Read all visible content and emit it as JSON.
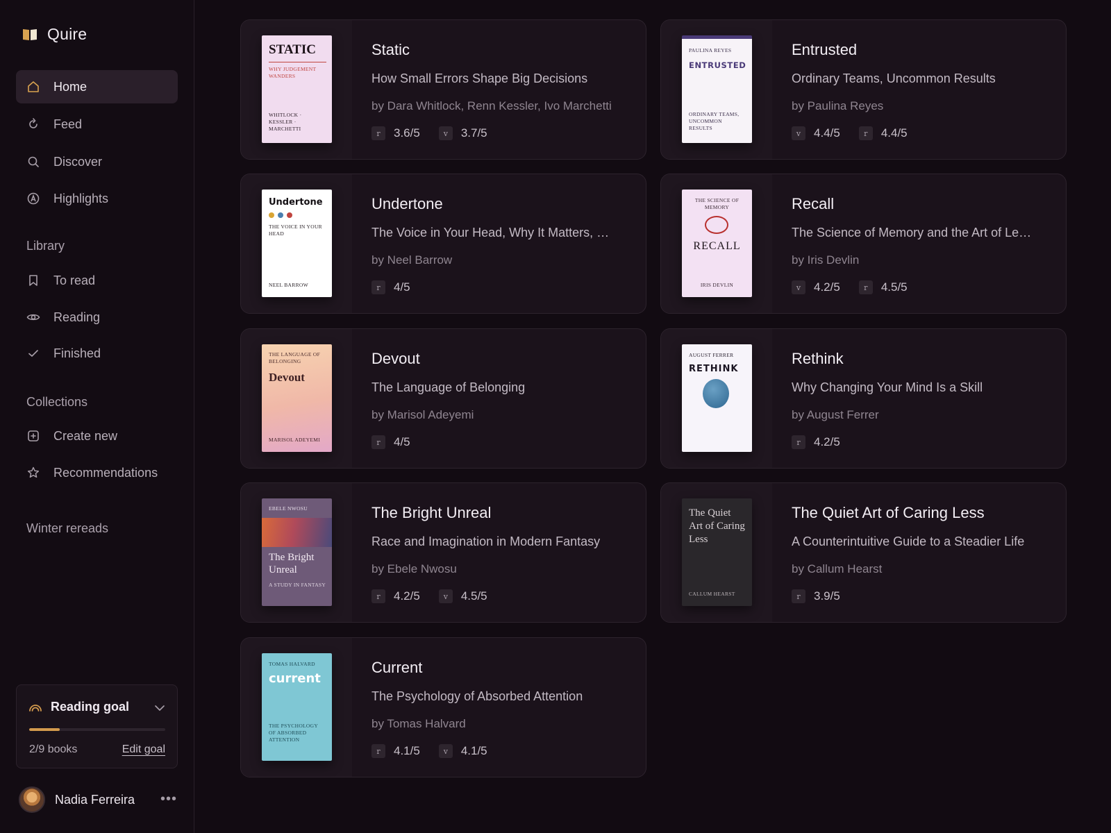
{
  "app": {
    "name": "Quire"
  },
  "nav": [
    {
      "label": "Home",
      "icon": "home-icon",
      "active": true
    },
    {
      "label": "Feed",
      "icon": "refresh-icon"
    },
    {
      "label": "Discover",
      "icon": "search-icon"
    },
    {
      "label": "Highlights",
      "icon": "highlight-icon"
    }
  ],
  "library": {
    "label": "Library",
    "items": [
      {
        "label": "To read",
        "icon": "bookmark-icon"
      },
      {
        "label": "Reading",
        "icon": "eye-icon"
      },
      {
        "label": "Finished",
        "icon": "check-icon"
      }
    ]
  },
  "collections": {
    "label": "Collections",
    "items": [
      {
        "label": "Create new",
        "icon": "plus-square-icon"
      },
      {
        "label": "Recommendations",
        "icon": "star-icon"
      }
    ],
    "custom": "Winter rereads"
  },
  "goal": {
    "title": "Reading goal",
    "count": "2/9 books",
    "edit": "Edit goal",
    "progress": 0.222,
    "color": "#d39a4d"
  },
  "user": {
    "name": "Nadia Ferreira",
    "more": "•••"
  },
  "books": [
    {
      "title": "Static",
      "subtitle": "How Small Errors Shape Big Decisions",
      "author": "by Dara Whitlock, Renn Kessler, Ivo Marchetti",
      "ratings": [
        {
          "icon": "r",
          "value": "3.6/5"
        },
        {
          "icon": "v",
          "value": "3.7/5"
        }
      ],
      "cover": {
        "title": "STATIC",
        "tagline": "WHY JUDGEMENT WANDERS",
        "author": "WHITLOCK · KESSLER · MARCHETTI",
        "bg": "#f1dcef",
        "accent": "#c0453f"
      }
    },
    {
      "title": "Entrusted",
      "subtitle": "Ordinary Teams, Uncommon Results",
      "author": "by Paulina Reyes",
      "ratings": [
        {
          "icon": "v",
          "value": "4.4/5"
        },
        {
          "icon": "r",
          "value": "4.4/5"
        }
      ],
      "cover": {
        "title": "ENTRUSTED",
        "tagline": "ORDINARY TEAMS, UNCOMMON RESULTS",
        "author": "PAULINA REYES",
        "bg": "#f7f3f8",
        "accent": "#4a3a78"
      }
    },
    {
      "title": "Undertone",
      "subtitle": "The Voice in Your Head, Why It Matters, …",
      "author": "by Neel Barrow",
      "ratings": [
        {
          "icon": "r",
          "value": "4/5"
        }
      ],
      "cover": {
        "title": "Undertone",
        "tagline": "THE VOICE IN YOUR HEAD",
        "author": "NEEL BARROW",
        "bg": "#ffffff",
        "accent": "#1a1a1a"
      }
    },
    {
      "title": "Recall",
      "subtitle": "The Science of Memory and the Art of Le…",
      "author": "by Iris Devlin",
      "ratings": [
        {
          "icon": "v",
          "value": "4.2/5"
        },
        {
          "icon": "r",
          "value": "4.5/5"
        }
      ],
      "cover": {
        "title": "RECALL",
        "tagline": "THE SCIENCE OF MEMORY",
        "author": "IRIS DEVLIN",
        "bg": "#f3e1f3",
        "accent": "#b8302e"
      }
    },
    {
      "title": "Devout",
      "subtitle": "The Language of Belonging",
      "author": "by Marisol Adeyemi",
      "ratings": [
        {
          "icon": "r",
          "value": "4/5"
        }
      ],
      "cover": {
        "title": "Devout",
        "tagline": "THE LANGUAGE OF BELONGING",
        "author": "MARISOL ADEYEMI",
        "bg": "#f0c6a8",
        "accent": "#3d1f22"
      }
    },
    {
      "title": "Rethink",
      "subtitle": "Why Changing Your Mind Is a Skill",
      "author": "by August Ferrer",
      "ratings": [
        {
          "icon": "r",
          "value": "4.2/5"
        }
      ],
      "cover": {
        "title": "RETHINK",
        "tagline": "",
        "author": "AUGUST FERRER",
        "bg": "#f7f4fa",
        "accent": "#3f7aa5"
      }
    },
    {
      "title": "The Bright Unreal",
      "subtitle": "Race and Imagination in Modern Fantasy",
      "author": "by Ebele Nwosu",
      "ratings": [
        {
          "icon": "r",
          "value": "4.2/5"
        },
        {
          "icon": "v",
          "value": "4.5/5"
        }
      ],
      "cover": {
        "title": "The Bright Unreal",
        "tagline": "A STUDY IN FANTASY",
        "author": "EBELE NWOSU",
        "bg": "#6e5a78",
        "accent": "#d86a3a"
      }
    },
    {
      "title": "The Quiet Art of Caring Less",
      "subtitle": "A Counterintuitive Guide to a Steadier Life",
      "author": "by Callum Hearst",
      "ratings": [
        {
          "icon": "r",
          "value": "3.9/5"
        }
      ],
      "cover": {
        "title": "The Quiet Art of Caring Less",
        "tagline": "",
        "author": "CALLUM HEARST",
        "bg": "#2a272b",
        "accent": "#cfc8c8"
      }
    },
    {
      "title": "Current",
      "subtitle": "The Psychology of Absorbed Attention",
      "author": "by Tomas Halvard",
      "ratings": [
        {
          "icon": "r",
          "value": "4.1/5"
        },
        {
          "icon": "v",
          "value": "4.1/5"
        }
      ],
      "cover": {
        "title": "current",
        "tagline": "THE PSYCHOLOGY OF ABSORBED ATTENTION",
        "author": "TOMAS HALVARD",
        "bg": "#7fc7d4",
        "accent": "#ffffff"
      }
    }
  ]
}
